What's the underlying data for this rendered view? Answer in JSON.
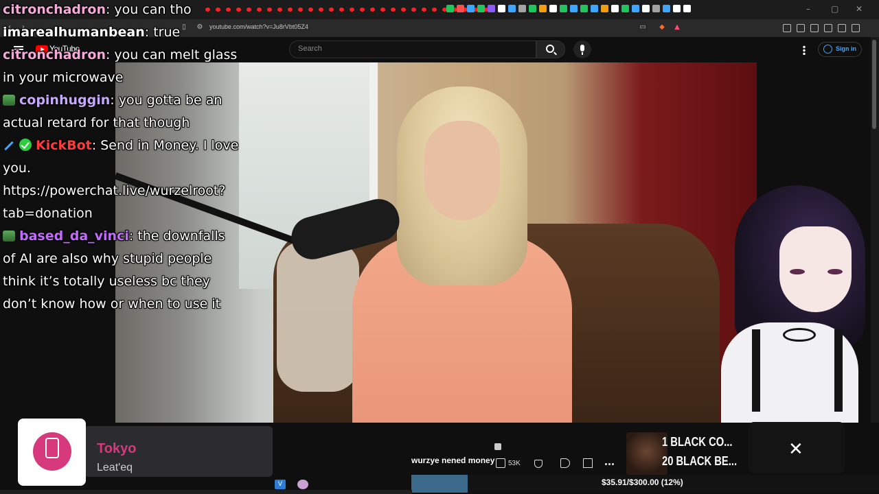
{
  "browser": {
    "url": "youtube.com/watch?v=Ju8rVbt05Z4",
    "window_controls": [
      "–",
      "▢",
      "✕"
    ],
    "tab_dot_count": 28,
    "tab_icon_colors": [
      "#21c55d",
      "#ff4d4d",
      "#3ea6ff",
      "#21c55d",
      "#8b5cf6",
      "#ffffff",
      "#3ea6ff",
      "#a3a3a3",
      "#21c55d",
      "#f59e0b",
      "#ffffff",
      "#21c55d",
      "#3ea6ff",
      "#21c55d",
      "#3ea6ff",
      "#f59e0b",
      "#ffffff",
      "#21c55d",
      "#3ea6ff",
      "#ffffff",
      "#a3a3a3",
      "#3ea6ff",
      "#ffffff",
      "#ffffff"
    ]
  },
  "youtube": {
    "logo_text": "YouTube",
    "search_placeholder": "Search",
    "sign_in_label": "Sign in"
  },
  "chat": {
    "messages": [
      {
        "badge": "",
        "user": "citronchadron",
        "color": "#f7a8d8",
        "text": "you can tho"
      },
      {
        "badge": "",
        "user": "imarealhumanbean",
        "color": "#ffffff",
        "text": "true"
      },
      {
        "badge": "",
        "user": "citronchadron",
        "color": "#f7a8d8",
        "text": "you can melt glass in your microwave"
      },
      {
        "badge": "pepe",
        "user": "copinhuggin",
        "color": "#c9a7ff",
        "text": "you gotta be an actual retard for that though"
      },
      {
        "badge": "sword,check",
        "user": "KickBot",
        "color": "#ff3b3b",
        "text": "Send in Money. I love you. https://powerchat.live/wurzelroot?tab=donation"
      },
      {
        "badge": "pepe",
        "user": "based_da_vinci",
        "color": "#c46bff",
        "text": "the downfalls of AI are also why stupid people think it’s totally useless bc they don’t know how or when to use it"
      }
    ]
  },
  "now_playing": {
    "title": "Tokyo",
    "artist": "Leat'eq",
    "accent": "#d63a7d"
  },
  "alert": {
    "text": "wurzye nened money"
  },
  "video_actions": {
    "likes": "53K"
  },
  "recommended": {
    "line1": "1 BLACK CO...",
    "line2": "20 BLACK BE..."
  },
  "donation_goal": {
    "text": "$35.91/$300.00 (12%)",
    "progress": 0.12
  },
  "taskbar": {
    "vs_label": "V"
  }
}
